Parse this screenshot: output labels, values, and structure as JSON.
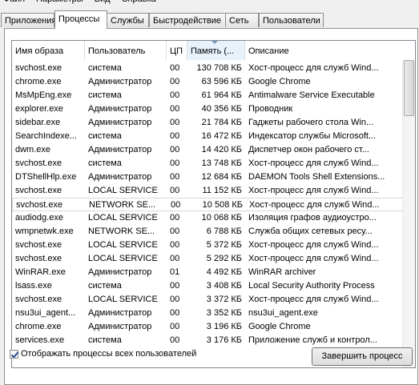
{
  "menubar": {
    "items": [
      "Файл",
      "Параметры",
      "Вид",
      "Справка"
    ]
  },
  "tabs": [
    {
      "label": "Приложения",
      "active": false
    },
    {
      "label": "Процессы",
      "active": true
    },
    {
      "label": "Службы",
      "active": false
    },
    {
      "label": "Быстродействие",
      "active": false
    },
    {
      "label": "Сеть",
      "active": false
    },
    {
      "label": "Пользователи",
      "active": false
    }
  ],
  "columns": {
    "name": "Имя образа",
    "user": "Пользователь",
    "cpu": "ЦП",
    "memory": "Память (...",
    "description": "Описание"
  },
  "rows": [
    [
      "svchost.exe",
      "система",
      "00",
      "130 708 КБ",
      "Хост-процесс для служб Wind..."
    ],
    [
      "chrome.exe",
      "Администратор",
      "00",
      "63 596 КБ",
      "Google Chrome"
    ],
    [
      "MsMpEng.exe",
      "система",
      "00",
      "61 964 КБ",
      "Antimalware Service Executable"
    ],
    [
      "explorer.exe",
      "Администратор",
      "00",
      "40 356 КБ",
      "Проводник"
    ],
    [
      "sidebar.exe",
      "Администратор",
      "00",
      "21 784 КБ",
      "Гаджеты рабочего стола Win..."
    ],
    [
      "SearchIndexe...",
      "система",
      "00",
      "16 472 КБ",
      "Индексатор службы Microsoft..."
    ],
    [
      "dwm.exe",
      "Администратор",
      "00",
      "14 420 КБ",
      "Диспетчер окон рабочего ст..."
    ],
    [
      "svchost.exe",
      "система",
      "00",
      "13 748 КБ",
      "Хост-процесс для служб Wind..."
    ],
    [
      "DTShellHlp.exe",
      "Администратор",
      "00",
      "12 684 КБ",
      "DAEMON Tools Shell Extensions..."
    ],
    [
      "svchost.exe",
      "LOCAL SERVICE",
      "00",
      "11 152 КБ",
      "Хост-процесс для служб Wind..."
    ],
    [
      "svchost.exe",
      "NETWORK SE...",
      "00",
      "10 508 КБ",
      "Хост-процесс для служб Wind..."
    ],
    [
      "audiodg.exe",
      "LOCAL SERVICE",
      "00",
      "10 068 КБ",
      "Изоляция графов аудиоустро..."
    ],
    [
      "wmpnetwk.exe",
      "NETWORK SE...",
      "00",
      "6 788 КБ",
      "Служба общих сетевых ресу..."
    ],
    [
      "svchost.exe",
      "LOCAL SERVICE",
      "00",
      "5 372 КБ",
      "Хост-процесс для служб Wind..."
    ],
    [
      "svchost.exe",
      "LOCAL SERVICE",
      "00",
      "5 292 КБ",
      "Хост-процесс для служб Wind..."
    ],
    [
      "WinRAR.exe",
      "Администратор",
      "01",
      "4 492 КБ",
      "WinRAR archiver"
    ],
    [
      "lsass.exe",
      "система",
      "00",
      "3 408 КБ",
      "Local Security Authority Process"
    ],
    [
      "svchost.exe",
      "LOCAL SERVICE",
      "00",
      "3 372 КБ",
      "Хост-процесс для служб Wind..."
    ],
    [
      "nsu3ui_agent...",
      "Администратор",
      "00",
      "3 352 КБ",
      "nsu3ui_agent.exe"
    ],
    [
      "chrome.exe",
      "Администратор",
      "00",
      "3 196 КБ",
      "Google Chrome"
    ],
    [
      "services.exe",
      "система",
      "00",
      "3 176 КБ",
      "Приложение служб и контрол..."
    ]
  ],
  "highlighted_row_index": 10,
  "show_all_checkbox": {
    "label": "Отображать процессы всех пользователей",
    "checked": true
  },
  "end_process_button": "Завершить процесс",
  "colors": {
    "sorted_header_bg": "#e8f2fb",
    "window_bg": "#f0f0f0"
  }
}
